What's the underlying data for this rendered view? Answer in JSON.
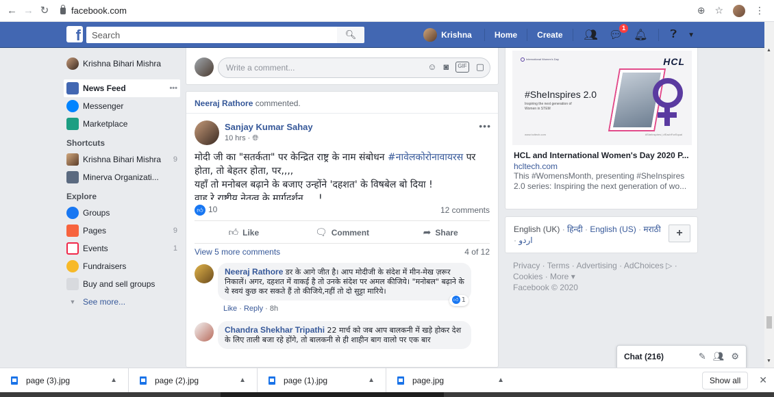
{
  "browser": {
    "url": "facebook.com"
  },
  "topbar": {
    "logo": "f",
    "search_placeholder": "Search",
    "user_name": "Krishna",
    "home": "Home",
    "create": "Create",
    "messenger_badge": "1"
  },
  "sidebar": {
    "profile": "Krishna Bihari Mishra",
    "news_feed": "News Feed",
    "news_feed_more": "•••",
    "messenger": "Messenger",
    "marketplace": "Marketplace",
    "shortcuts_heading": "Shortcuts",
    "shortcuts": [
      {
        "label": "Krishna Bihari Mishra",
        "count": "9"
      },
      {
        "label": "Minerva Organizati...",
        "count": ""
      }
    ],
    "explore_heading": "Explore",
    "explore": [
      {
        "label": "Groups",
        "count": ""
      },
      {
        "label": "Pages",
        "count": "9"
      },
      {
        "label": "Events",
        "count": "1"
      },
      {
        "label": "Fundraisers",
        "count": ""
      },
      {
        "label": "Buy and sell groups",
        "count": ""
      }
    ],
    "see_more": "See more..."
  },
  "composer": {
    "placeholder": "Write a comment..."
  },
  "post": {
    "activity_actor": "Neeraj Rathore",
    "activity_text": "commented.",
    "author": "Sanjay Kumar Sahay",
    "time": "10 hrs ·",
    "text_1": "मोदी जी का \"सतर्कता\" पर केन्द्रित राष्ट्र के नाम संबोधन ",
    "hashtag": "#नावेलकोरोनावायरस",
    "text_2": " पर होता, तो बेहतर होता, पर,,,,",
    "text_3": "यहाँ तो मनोबल बढ़ाने के बजाए उन्होंने 'दहशत' के विषबेल बो दिया !",
    "text_4": "वाह रे राष्ट्रीय नेतृत्व के मार्गदर्शन,,,,,!",
    "likes": "10",
    "comments_count": "12 comments",
    "like_label": "Like",
    "comment_label": "Comment",
    "share_label": "Share",
    "view_more": "View 5 more comments",
    "pager": "4 of 12"
  },
  "comments": [
    {
      "name": "Neeraj Rathore",
      "text": "डर के आगे जीत है। आप मोदीजी के संदेश में मीन-मेख ज़रूर निकालें। अगर, दहशत में वाकई है तो उनके संदेश पर अमल कीजिये। \"मनोबल\" बढ़ाने के ये स्वयं कुछ कर सकते हैं तो कीजिये,नहीं तो दो सुट्टा मारिये।",
      "reactions": "1",
      "like": "Like",
      "reply": "Reply",
      "time": "8h"
    },
    {
      "name": "Chandra Shekhar Tripathi",
      "text": "22 मार्च को जब आप बालकनी में खड़े होकर देश के लिए ताली बजा रहे होंगे, तो बालकनी से ही शाहीन बाग वालो पर एक बार"
    }
  ],
  "ad": {
    "brand": "HCL",
    "org": "International Women's Day",
    "headline": "#SheInspires 2.0",
    "sub": "Inspiring the next generation of Women in STEM",
    "foot_left": "www.hcltech.com",
    "foot_right": "#SheInspires | #EachForEqual",
    "title": "HCL and International Women's Day 2020 P...",
    "domain": "hcltech.com",
    "desc": "This #WomensMonth, presenting #SheInspires 2.0 series: Inspiring the next generation of wo..."
  },
  "languages": {
    "current": "English (UK)",
    "hindi": "हिन्दी",
    "english_us": "English (US)",
    "marathi": "मराठी",
    "urdu": "اردو",
    "plus": "+"
  },
  "footer": {
    "line1": "Privacy · Terms · Advertising · AdChoices ▷ ·",
    "line2": "Cookies · More ▾",
    "copyright": "Facebook © 2020"
  },
  "chat": {
    "label": "Chat (216)"
  },
  "downloads": {
    "files": [
      "page (3).jpg",
      "page (2).jpg",
      "page (1).jpg",
      "page.jpg"
    ],
    "show_all": "Show all"
  }
}
